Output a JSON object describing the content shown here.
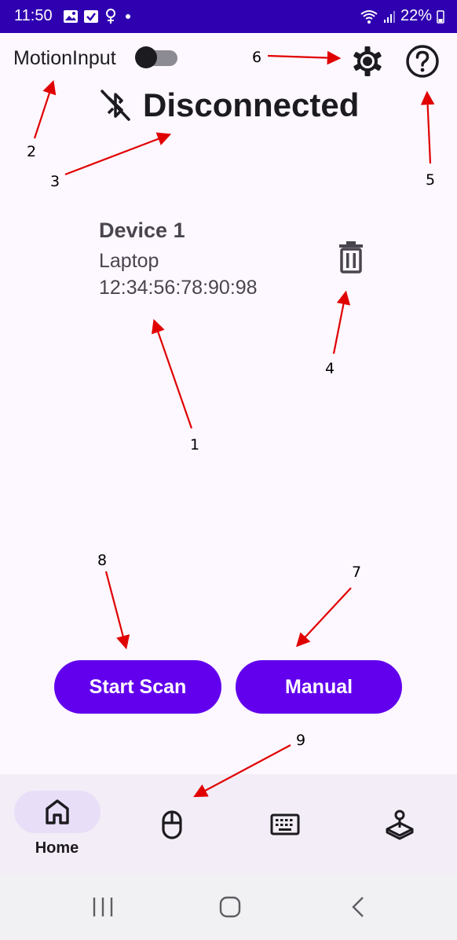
{
  "status_bar": {
    "time": "11:50",
    "battery": "22%",
    "icons": [
      "image-icon",
      "check-icon",
      "female-icon",
      "dot-icon",
      "wifi-icon",
      "signal-icon",
      "battery-icon"
    ]
  },
  "header": {
    "app_title": "MotionInput",
    "toggle_on": false
  },
  "connection": {
    "status": "Disconnected"
  },
  "device": {
    "name": "Device 1",
    "type": "Laptop",
    "mac": "12:34:56:78:90:98"
  },
  "actions": {
    "start_scan": "Start Scan",
    "manual": "Manual"
  },
  "bottom_nav": {
    "items": [
      {
        "label": "Home",
        "icon": "home-icon",
        "selected": true
      },
      {
        "label": "",
        "icon": "mouse-icon",
        "selected": false
      },
      {
        "label": "",
        "icon": "keyboard-icon",
        "selected": false
      },
      {
        "label": "",
        "icon": "joystick-icon",
        "selected": false
      }
    ]
  },
  "annotations": [
    "1",
    "2",
    "3",
    "4",
    "5",
    "6",
    "7",
    "8",
    "9"
  ],
  "colors": {
    "status_bar": "#2f00b0",
    "accent": "#6200ee",
    "background": "#fdf7ff",
    "nav_background": "#f3edf7",
    "nav_pill": "#e8def8",
    "annotation_arrow": "#e00000"
  }
}
